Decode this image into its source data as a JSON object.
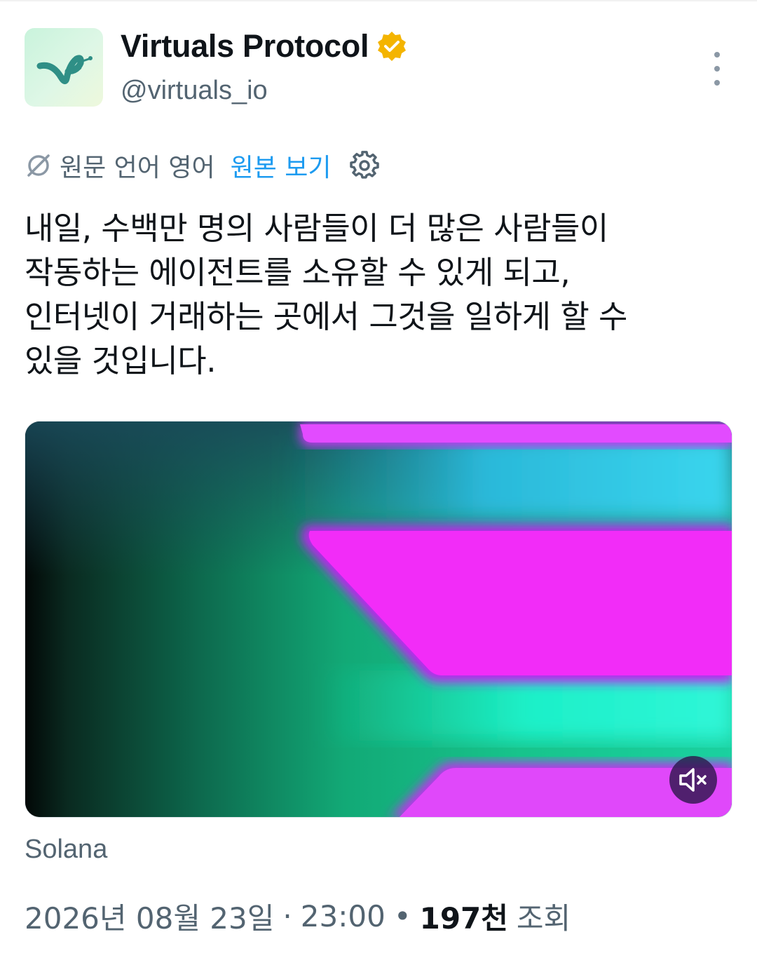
{
  "tweet": {
    "author": {
      "display_name": "Virtuals Protocol",
      "handle": "@virtuals_io",
      "verified": true,
      "badge_color": "#f4b400",
      "avatar_icon": "virtuals-logo-icon"
    },
    "translation": {
      "source_language": "원문 언어 영어",
      "view_original": "원본 보기",
      "accent_color": "#1d9bf0"
    },
    "text": "내일, 수백만 명의 사람들이 더 많은 사람들이\n작동하는 에이전트를 소유할 수 있게 되고,\n인터넷이 거래하는 곳에서 그것을 일하게 할 수\n있을 것입니다.",
    "media": {
      "type": "video",
      "caption": "Solana",
      "muted": true
    },
    "meta": {
      "date": "2026년 08월 23일",
      "separator": "·",
      "time": "23:00",
      "views_count": "197천",
      "views_label": "조회"
    }
  }
}
